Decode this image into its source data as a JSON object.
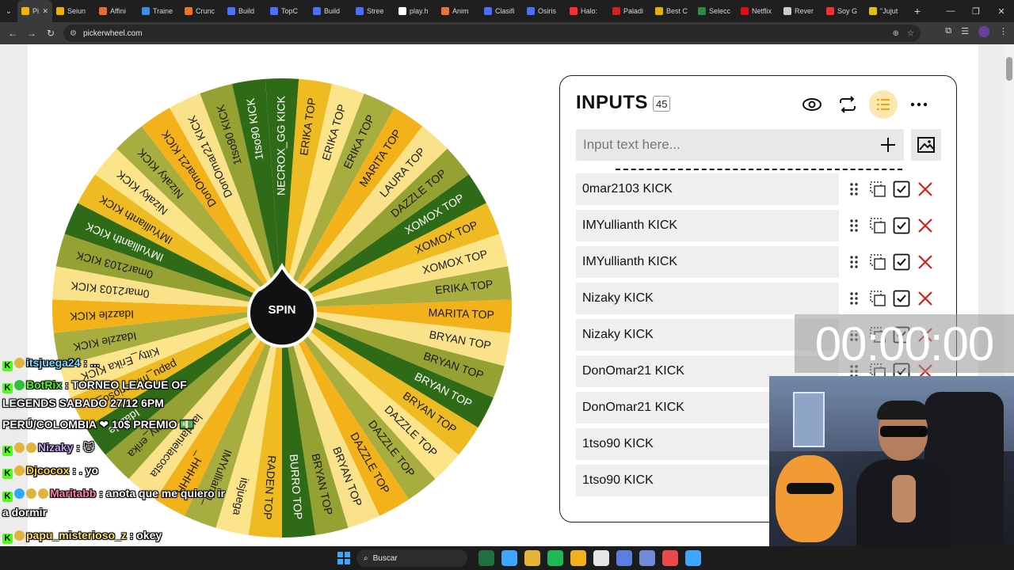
{
  "browser": {
    "tabs": [
      {
        "label": "Pi",
        "color": "#f5b400",
        "active": true
      },
      {
        "label": "Seiun",
        "color": "#e8b000"
      },
      {
        "label": "Affini",
        "color": "#e86a2c"
      },
      {
        "label": "Traine",
        "color": "#3a8ee6"
      },
      {
        "label": "Crunc",
        "color": "#f47521"
      },
      {
        "label": "Build",
        "color": "#4c6fff"
      },
      {
        "label": "TopC",
        "color": "#4c6fff"
      },
      {
        "label": "Build",
        "color": "#4c6fff"
      },
      {
        "label": "Stree",
        "color": "#4c6fff"
      },
      {
        "label": "play.h",
        "color": "#ffffff"
      },
      {
        "label": "Anim",
        "color": "#e8743b"
      },
      {
        "label": "Clasifi",
        "color": "#4c6fff"
      },
      {
        "label": "Osiris",
        "color": "#4c6fff"
      },
      {
        "label": "Halo:",
        "color": "#ff2d2d"
      },
      {
        "label": "Paladi",
        "color": "#d62020"
      },
      {
        "label": "Best C",
        "color": "#e8b000"
      },
      {
        "label": "Selecc",
        "color": "#2a8a4a"
      },
      {
        "label": "Netflix",
        "color": "#e50914"
      },
      {
        "label": "Rever",
        "color": "#cccccc"
      },
      {
        "label": "Soy G",
        "color": "#ff2d2d"
      },
      {
        "label": "\"Jujut",
        "color": "#e8c000"
      }
    ],
    "url": "pickerwheel.com"
  },
  "wheel": {
    "spin_label": "SPIN",
    "segments": [
      "NECROX_GG KICK",
      "ERIKA TOP",
      "ERIKA TOP",
      "ERIKA TOP",
      "MARITA TOP",
      "LAURA TOP",
      "DAZZLE TOP",
      "XOMOX TOP",
      "XOMOX TOP",
      "XOMOX TOP",
      "ERIKA TOP",
      "MARITA TOP",
      "BRYAN TOP",
      "BRYAN TOP",
      "BRYAN TOP",
      "BRYAN TOP",
      "DAZZLE TOP",
      "DAZZLE TOP",
      "DAZZLE TOP",
      "BRYAN TOP",
      "BRYAN TOP",
      "BURRO TOP",
      "RADEN TOP",
      "itsjuega",
      "IMYullianth_",
      "_HHHHH",
      "laudanielacosta",
      "kitty_erika",
      "Idazzle",
      "papu_misterioso_z",
      "Kitty_Erika KICK",
      "Idazzle KICK",
      "Idazzle KICK",
      "0mar2103 KICK",
      "0mar2103 KICK",
      "IMYullianth KICK",
      "IMYullianth KICK",
      "Nizaky KICK",
      "Nizaky KICK",
      "DonOmar21 KICK",
      "DonOmar21 KICK",
      "1tso90 KICK",
      "1tso90 KICK"
    ],
    "colors": [
      "#2f6b16",
      "#eebb22",
      "#fbe48a",
      "#a8ad3f",
      "#f3b21a",
      "#f9e28a",
      "#95a132"
    ]
  },
  "inputs_panel": {
    "title": "INPUTS",
    "count": "45",
    "placeholder": "Input text here...",
    "entries": [
      "0mar2103 KICK",
      "0mar2103 KICK",
      "IMYullianth KICK",
      "IMYullianth KICK",
      "Nizaky KICK",
      "Nizaky KICK",
      "DonOmar21 KICK",
      "DonOmar21 KICK",
      "1tso90 KICK",
      "1tso90 KICK"
    ]
  },
  "timer": "00:00:00",
  "chat": [
    {
      "user": "itsjuega24",
      "msg": " : ..."
    },
    {
      "user": "BotRix",
      "msg": " : TORNEO LEAGUE OF"
    },
    {
      "user": "",
      "msg": "LEGENDS SABADO 27/12 6PM"
    },
    {
      "user": "",
      "msg": "PERÚ/COLOMBIA ❤ 10$ PREMIO 💵"
    },
    {
      "user": "Nizaky",
      "msg": " : 🐱"
    },
    {
      "user": "Djcocox",
      "msg": " : . yo"
    },
    {
      "user": "Maritabb",
      "msg": " : anota que me quiero ir"
    },
    {
      "user": "",
      "msg": "a dormir"
    },
    {
      "user": "papu_misterioso_z",
      "msg": " : okey"
    },
    {
      "user": "Djcocox",
      "msg": " : . yo"
    }
  ],
  "taskbar": {
    "search_label": "Buscar",
    "apps": [
      "#1f6f3f",
      "#3ea6ff",
      "#e7b43a",
      "#1db954",
      "#f2b01e",
      "#e5e5e5",
      "#5b7fe0",
      "#7289da",
      "#e84a4a",
      "#3ea6ff"
    ]
  }
}
